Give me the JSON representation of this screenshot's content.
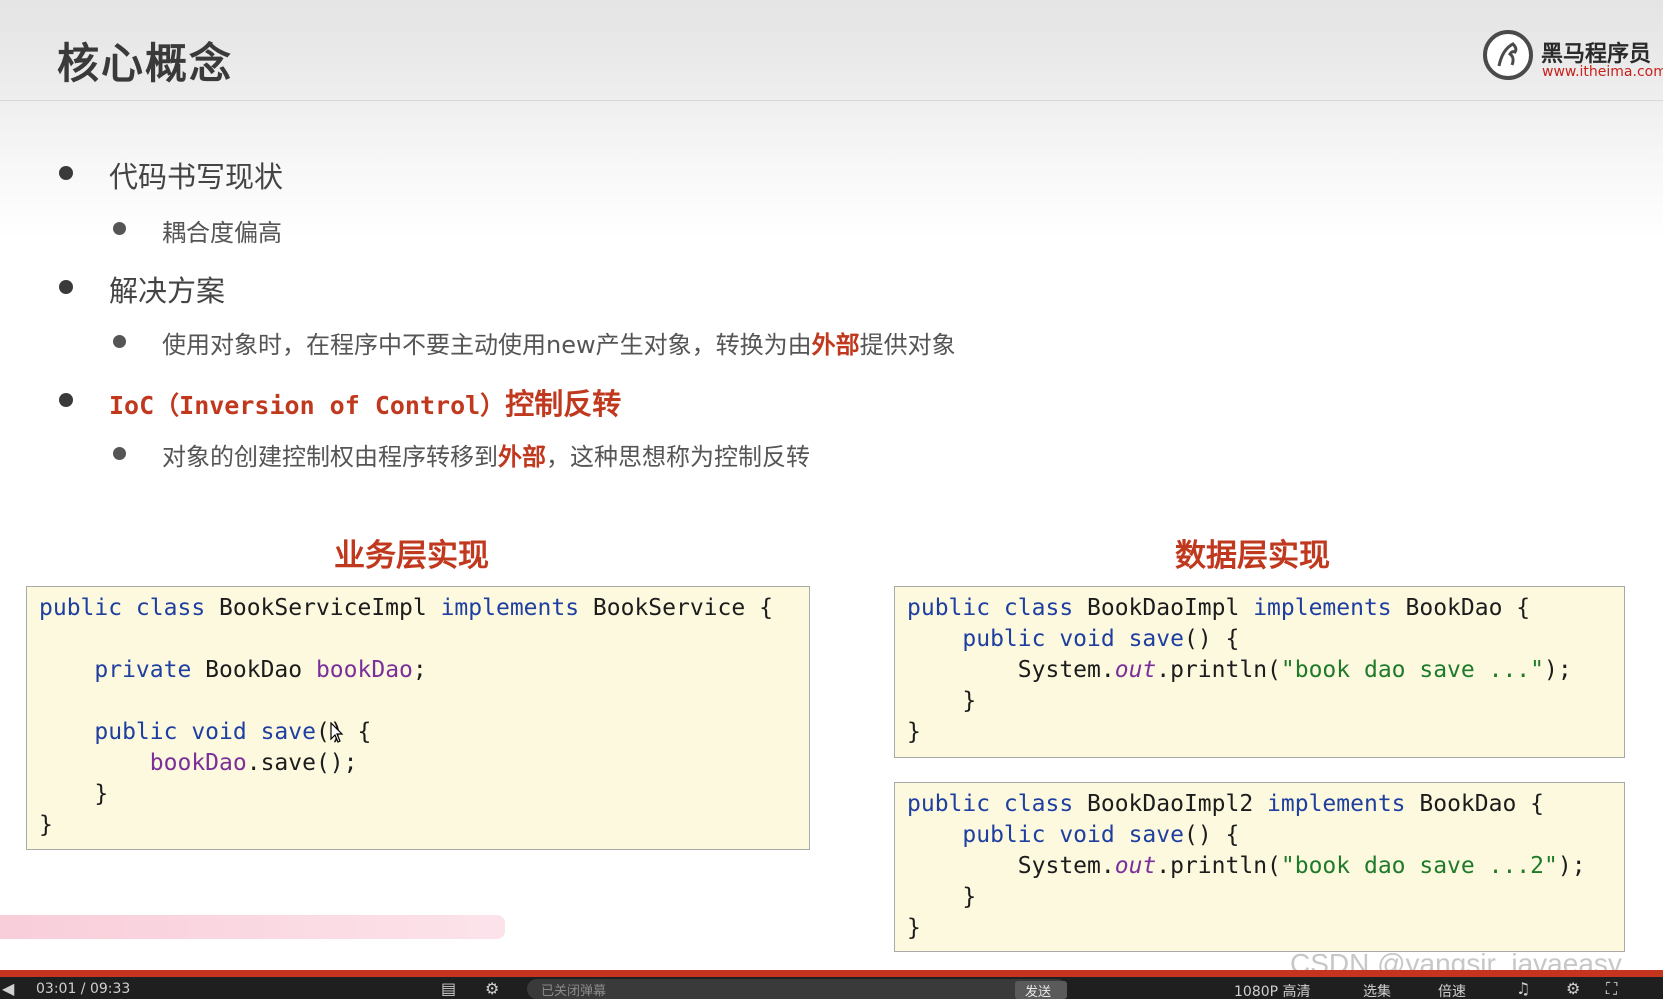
{
  "header": {
    "title": "核心概念",
    "logo_text": "黑马程序员",
    "logo_url_text": "www.itheima.com",
    "logo_icon": "horse-icon"
  },
  "bullets": {
    "item1": "代码书写现状",
    "item1_sub": "耦合度偏高",
    "item2": "解决方案",
    "item2_sub_pre": "使用对象时，在程序中不要主动使用new产生对象，转换为由",
    "item2_sub_red": "外部",
    "item2_sub_post": "提供对象",
    "item3_mono": "IoC（Inversion of Control）",
    "item3_cn": "控制反转",
    "item3_sub_pre": "对象的创建控制权由程序转移到",
    "item3_sub_red": "外部",
    "item3_sub_post": "，这种思想称为控制反转"
  },
  "sections": {
    "service_title": "业务层实现",
    "dao_title": "数据层实现"
  },
  "code": {
    "service": {
      "l1_kw": "public class",
      "l1_name": " BookServiceImpl ",
      "l1_kw2": "implements",
      "l1_tail": " BookService {",
      "l3_kw": "    private",
      "l3_type": " BookDao ",
      "l3_field": "bookDao",
      "l3_tail": ";",
      "l5_kw": "    public void",
      "l5_method": " save",
      "l5_tail": "() {",
      "l6_field": "        bookDao",
      "l6_tail": ".save();",
      "l7": "    }",
      "l8": "}"
    },
    "dao1": {
      "l1_kw": "public class",
      "l1_name": " BookDaoImpl ",
      "l1_kw2": "implements",
      "l1_tail": " BookDao {",
      "l2_kw": "    public void",
      "l2_method": " save",
      "l2_tail": "() {",
      "l3_pre": "        System.",
      "l3_out": "out",
      "l3_mid": ".println(",
      "l3_str": "\"book dao save ...\"",
      "l3_tail": ");",
      "l4": "    }",
      "l5": "}"
    },
    "dao2": {
      "l1_kw": "public class",
      "l1_name": " BookDaoImpl2 ",
      "l1_kw2": "implements",
      "l1_tail": " BookDao {",
      "l2_kw": "    public void",
      "l2_method": " save",
      "l2_tail": "() {",
      "l3_pre": "        System.",
      "l3_out": "out",
      "l3_mid": ".println(",
      "l3_str": "\"book dao save ...2\"",
      "l3_tail": ");",
      "l4": "    }",
      "l5": "}"
    }
  },
  "player": {
    "time": "03:01 / 09:33",
    "danmaku_placeholder": "已关闭弹幕",
    "send_label": "发送",
    "quality": "1080P 高清",
    "select": "选集",
    "speed": "倍速",
    "accent_color": "#c4341e"
  },
  "watermark": "CSDN @yangsir_javaeasy"
}
